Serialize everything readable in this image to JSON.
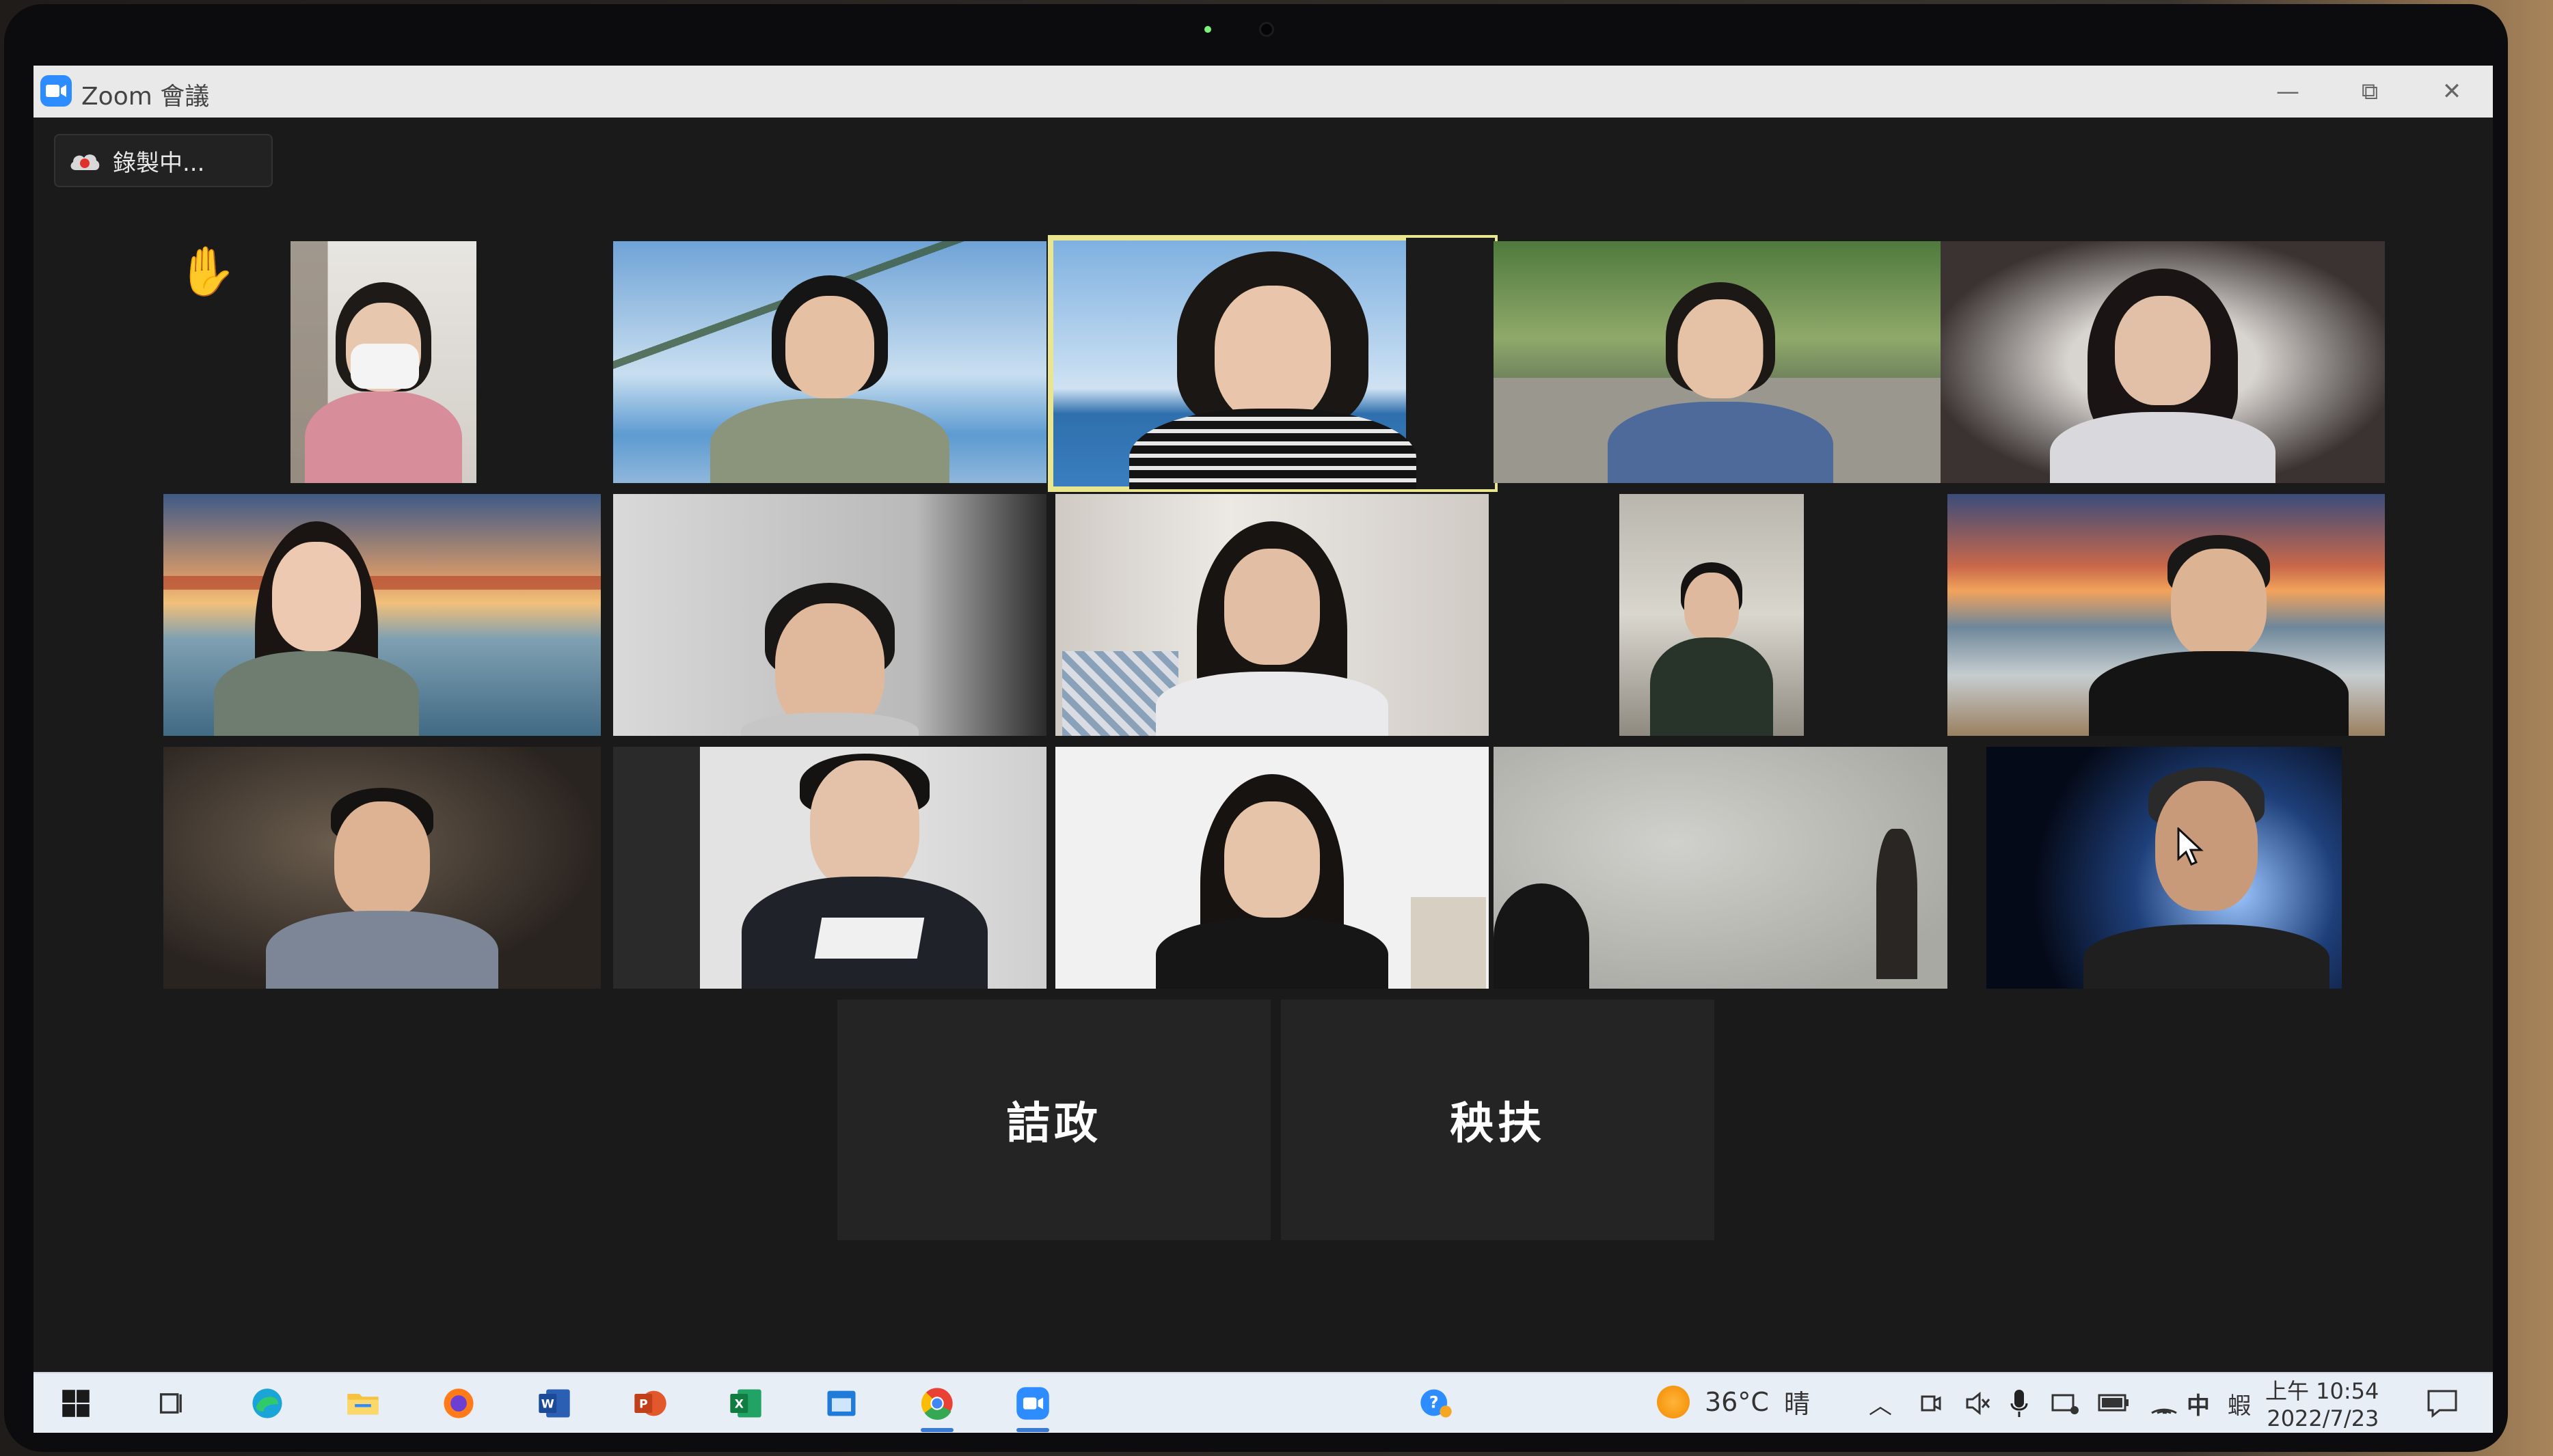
{
  "window": {
    "title": "Zoom 會議",
    "minimize": "—",
    "restore": "⧉",
    "close": "✕"
  },
  "recording": {
    "label": "錄製中..."
  },
  "participants_named": [
    {
      "name": "詰政"
    },
    {
      "name": "秧扶"
    }
  ],
  "taskbar": {
    "weather_temp": "36°C",
    "weather_cond": "晴",
    "ime": "中",
    "ime2": "蝦",
    "time": "上午 10:54",
    "date": "2022/7/23"
  },
  "colors": {
    "active_speaker_border": "#e9e68f",
    "zoom_blue": "#2d8cff",
    "taskbar_bg": "#e8eef6"
  }
}
